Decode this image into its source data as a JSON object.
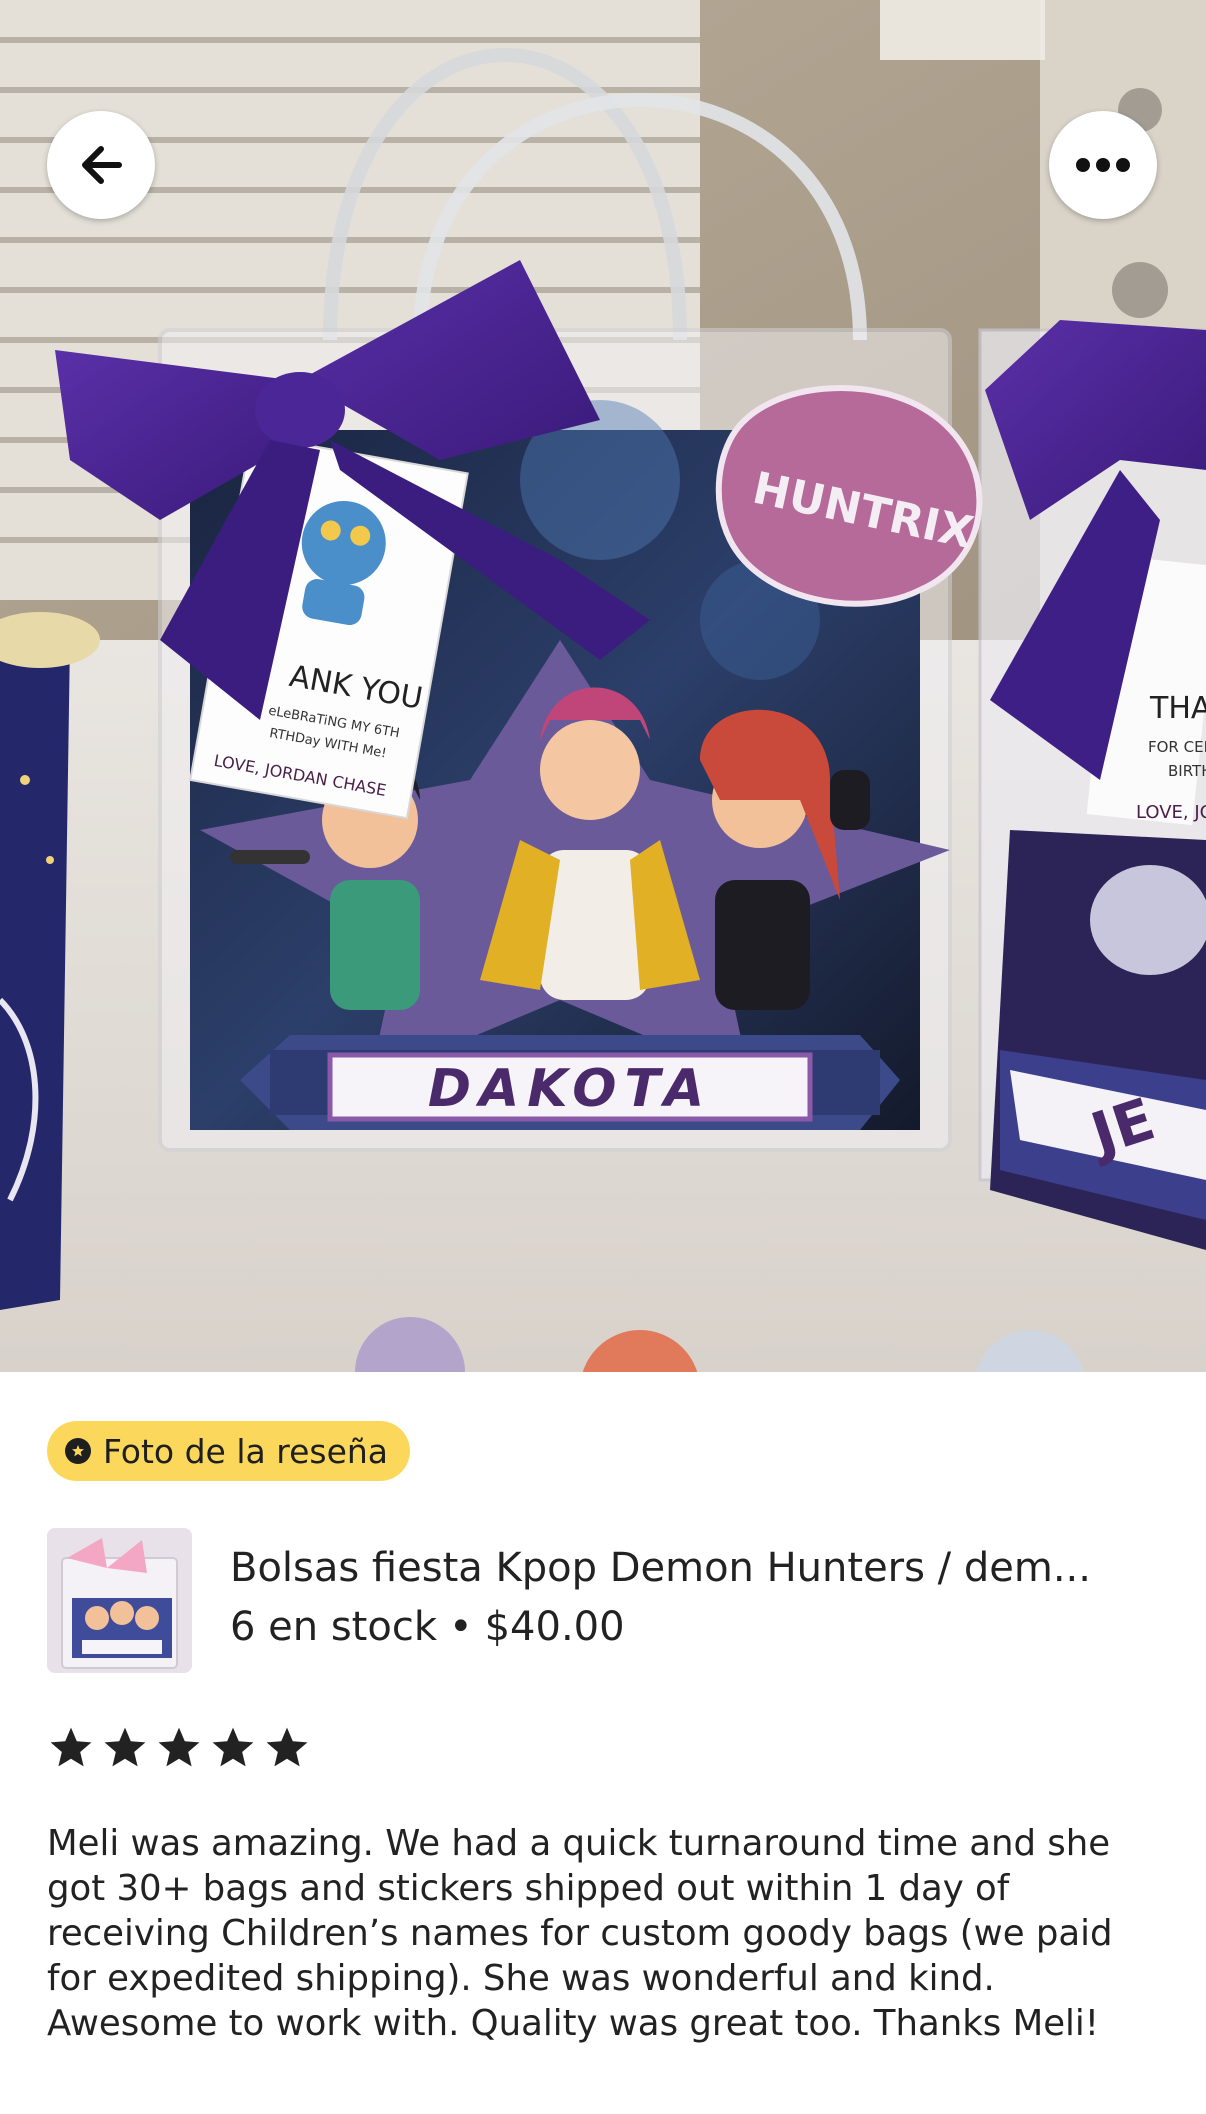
{
  "photo": {
    "tag_heading": "ANK YOU",
    "tag_line_1": "eLeBRaTiNG MY 6TH",
    "tag_line_2": "RTHDay WITH Me!",
    "tag_signature": "LOVE, JORDAN CHASE",
    "sticker_logo": "HUNTRIX",
    "banner_name": "DAKOTA",
    "right_tag_heading": "THA",
    "right_tag_line_1": "FOR CELE",
    "right_tag_line_2": "BIRTH",
    "right_tag_signature": "LOVE, JO",
    "right_banner_name": "JE"
  },
  "controls": {
    "back_icon": "arrow-left-icon",
    "more_icon": "more-horizontal-icon"
  },
  "badge": {
    "icon": "review-photo-icon",
    "label": "Foto de la reseña"
  },
  "listing": {
    "title": "Bolsas fiesta Kpop Demon Hunters / dem...",
    "stock": "6 en stock",
    "separator": "•",
    "price": "$40.00"
  },
  "review": {
    "rating": 5,
    "max_rating": 5,
    "text": "Meli was amazing. We had a quick turnaround time and she got 30+ bags and stickers shipped out within 1 day of receiving Children’s names for custom goody bags (we paid for expedited shipping). She was wonderful and kind. Awesome to work with. Quality was great too. Thanks Meli!"
  },
  "colors": {
    "badge_bg": "#fbd85b",
    "ribbon": "#4a2590",
    "star": "#222222",
    "text": "#222222"
  }
}
